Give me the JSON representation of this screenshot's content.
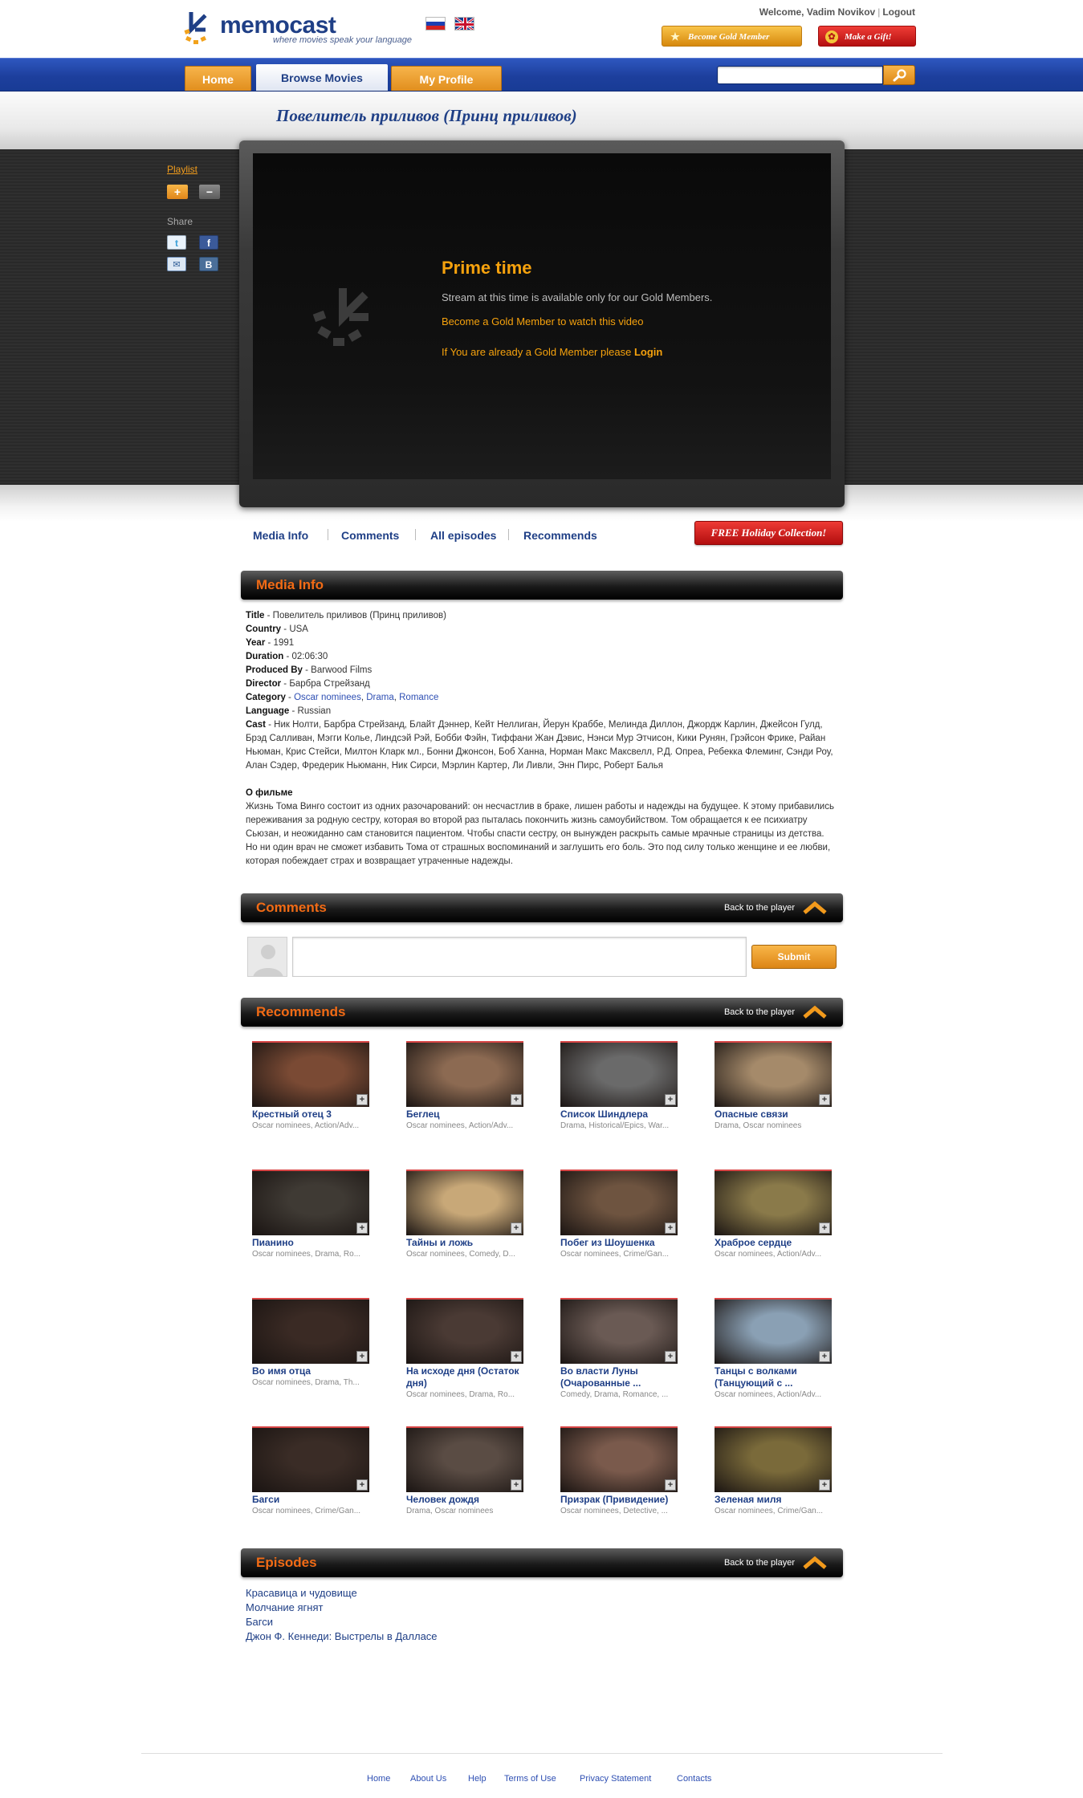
{
  "header": {
    "logo_name": "memocast",
    "logo_slogan": "where movies speak your language",
    "welcome_text": "Welcome, Vadim Novikov",
    "logout_label": "Logout",
    "gold_button_label": "Become Gold Member",
    "gift_button_label": "Make a Gift!"
  },
  "nav": {
    "home": "Home",
    "browse": "Browse Movies",
    "profile": "My Profile",
    "search_value": ""
  },
  "movie": {
    "title": "Повелитель приливов (Принц приливов)"
  },
  "sidebar": {
    "playlist_label": "Playlist",
    "add_label": "+",
    "remove_label": "−",
    "share_label": "Share"
  },
  "player": {
    "prime_title": "Prime time",
    "prime_desc": "Stream at this time is available only for our Gold Members.",
    "become_link": "Become a Gold Member to watch this video",
    "already_text": "If You are already a Gold Member please",
    "login_link": "Login"
  },
  "subtabs": {
    "media_info": "Media Info",
    "comments": "Comments",
    "all_episodes": "All episodes",
    "recommends": "Recommends",
    "holiday_button": "FREE Holiday Collection!"
  },
  "media_info": {
    "section_title": "Media Info",
    "title_label": "Title",
    "title_value": "Повелитель приливов (Принц приливов)",
    "country_label": "Country",
    "country_value": "USA",
    "year_label": "Year",
    "year_value": "1991",
    "duration_label": "Duration",
    "duration_value": "02:06:30",
    "produced_label": "Produced By",
    "produced_value": "Barwood Films",
    "director_label": "Director",
    "director_value": "Барбра Стрейзанд",
    "category_label": "Category",
    "categories": [
      "Oscar nominees",
      "Drama",
      "Romance"
    ],
    "language_label": "Language",
    "language_value": "Russian",
    "cast_label": "Cast",
    "cast_value": "Ник Нолти, Барбра Стрейзанд, Блайт Дэннер, Кейт Неллиган, Йерун Краббе, Мелинда Диллон, Джордж Карлин, Джейсон Гулд, Брэд Салливан, Мэгги Колье, Линдсэй Рэй, Бобби Фэйн, Тиффани Жан Дэвис, Нэнси Мур Этчисон, Кики Рунян, Грэйсон Фрике, Райан Ньюман, Крис Стейси, Милтон Кларк мл., Бонни Джонсон, Боб Ханна, Норман Макс Максвелл, Р.Д. Опреа, Ребекка Флеминг, Сэнди Роу, Алан Сэдер, Фредерик Ньюманн, Ник Сирси, Мэрлин Картер, Ли Ливли, Энн Пирс, Роберт Балья",
    "about_title": "О фильме",
    "about_text": "Жизнь Тома Винго состоит из одних разочарований: он несчастлив в браке, лишен работы и надежды на будущее. К этому прибавились переживания за родную сестру, которая во второй раз пыталась покончить жизнь самоубийством. Том обращается к ее психиатру Сьюзан, и неожиданно сам становится пациентом. Чтобы спасти сестру, он вынужден раскрыть самые мрачные страницы из детства. Но ни один врач не сможет избавить Тома от страшных воспоминаний и заглушить его боль. Это под силу только женщине и ее любви, которая побеждает страх и возвращает утраченные надежды."
  },
  "comments": {
    "section_title": "Comments",
    "back_label": "Back to the player",
    "input_value": "",
    "submit_label": "Submit"
  },
  "recommends": {
    "section_title": "Recommends",
    "back_label": "Back to the player",
    "items": [
      {
        "title": "Крестный отец 3",
        "genre": "Oscar nominees, Action/Adv...",
        "color": "#7a4a34"
      },
      {
        "title": "Беглец",
        "genre": "Oscar nominees, Action/Adv...",
        "color": "#8c6a52"
      },
      {
        "title": "Список Шиндлера",
        "genre": "Drama, Historical/Epics, War...",
        "color": "#6a6a6a"
      },
      {
        "title": "Опасные связи",
        "genre": "Drama, Oscar nominees",
        "color": "#a58a6a"
      },
      {
        "title": "Пианино",
        "genre": "Oscar nominees, Drama, Ro...",
        "color": "#3f3a34"
      },
      {
        "title": "Тайны и ложь",
        "genre": "Oscar nominees, Comedy, D...",
        "color": "#c8a878"
      },
      {
        "title": "Побег из Шоушенка",
        "genre": "Oscar nominees, Crime/Gan...",
        "color": "#6e5440"
      },
      {
        "title": "Храброе сердце",
        "genre": "Oscar nominees, Action/Adv...",
        "color": "#8a7a4a"
      },
      {
        "title": "Во имя отца",
        "genre": "Oscar nominees, Drama, Th...",
        "color": "#3a2a24"
      },
      {
        "title": "На исходе дня (Остаток дня)",
        "genre": "Oscar nominees, Drama, Ro...",
        "color": "#4a3a34"
      },
      {
        "title": "Во власти Луны (Очарованные ...",
        "genre": "Comedy, Drama, Romance, ...",
        "color": "#6a5a54"
      },
      {
        "title": "Танцы с волками (Танцующий с ...",
        "genre": "Oscar nominees, Action/Adv...",
        "color": "#8aa0b4"
      },
      {
        "title": "Багси",
        "genre": "Oscar nominees, Crime/Gan...",
        "color": "#3a2c26"
      },
      {
        "title": "Человек дождя",
        "genre": "Drama, Oscar nominees",
        "color": "#5a4c44"
      },
      {
        "title": "Призрак (Привидение)",
        "genre": "Oscar nominees, Detective, ...",
        "color": "#7a5a4c"
      },
      {
        "title": "Зеленая миля",
        "genre": "Oscar nominees, Crime/Gan...",
        "color": "#7a6a3a"
      }
    ]
  },
  "episodes": {
    "section_title": "Episodes",
    "back_label": "Back to the player",
    "items": [
      "Красавица и чудовище",
      "Молчание ягнят",
      "Багси",
      "Джон Ф. Кеннеди: Выстрелы в Далласе"
    ]
  },
  "footer": {
    "links": [
      "Home",
      "About Us",
      "Help",
      "Terms of Use",
      "Privacy Statement",
      "Contacts"
    ]
  },
  "colors": {
    "brand_blue": "#1f3f86",
    "accent_orange": "#f26b15",
    "gold": "#f6a20d"
  }
}
